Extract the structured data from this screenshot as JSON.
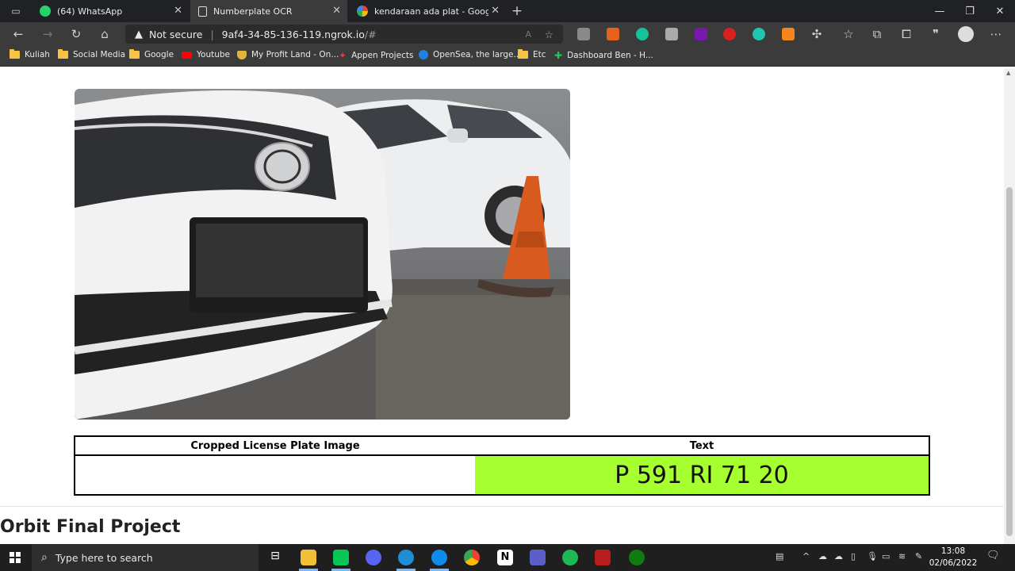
{
  "tabs": [
    {
      "title": "(64) WhatsApp",
      "icon": "whatsapp-icon",
      "active": false
    },
    {
      "title": "Numberplate OCR",
      "icon": "page-icon",
      "active": true
    },
    {
      "title": "kendaraan ada plat - Google Sea",
      "icon": "google-icon",
      "active": false
    }
  ],
  "address_bar": {
    "security_label": "Not secure",
    "url_main": "9af4-34-85-136-119.ngrok.io",
    "url_rest": "/#"
  },
  "bookmarks": [
    {
      "label": "Kuliah",
      "icon": "folder-icon"
    },
    {
      "label": "Social Media",
      "icon": "folder-icon"
    },
    {
      "label": "Google",
      "icon": "folder-icon"
    },
    {
      "label": "Youtube",
      "icon": "youtube-icon"
    },
    {
      "label": "My Profit Land - On...",
      "icon": "shield-icon"
    },
    {
      "label": "Appen Projects",
      "icon": "appen-icon"
    },
    {
      "label": "OpenSea, the large...",
      "icon": "opensea-icon"
    },
    {
      "label": "Etc",
      "icon": "folder-icon"
    },
    {
      "label": "Dashboard Ben - H...",
      "icon": "plus-icon"
    }
  ],
  "result_table": {
    "headers": [
      "Cropped License Plate Image",
      "Text"
    ],
    "plate_text": "P 591 RI 71 20"
  },
  "footer": {
    "title": "Orbit Final Project"
  },
  "taskbar": {
    "search_placeholder": "Type here to search",
    "time": "13:08",
    "date": "02/06/2022"
  },
  "colors": {
    "plate_highlight": "#a6ff2e",
    "browser_dark": "#3b3b3b"
  }
}
